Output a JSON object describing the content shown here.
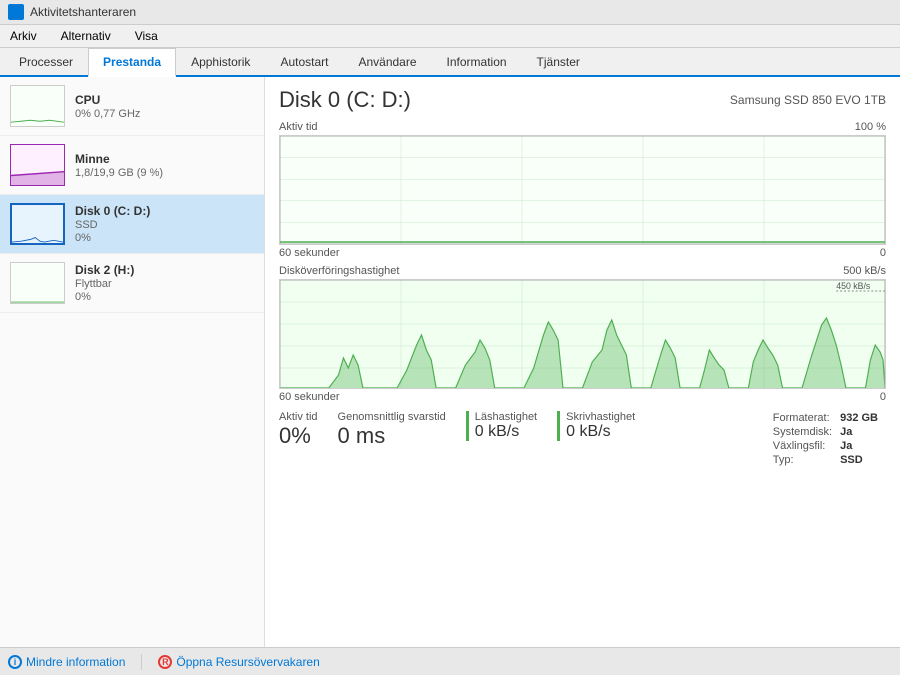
{
  "titleBar": {
    "text": "Aktivitetshanteraren",
    "iconColor": "#0078d7"
  },
  "menuBar": {
    "items": [
      "Arkiv",
      "Alternativ",
      "Visa"
    ]
  },
  "tabs": {
    "items": [
      "Processer",
      "Prestanda",
      "Apphistorik",
      "Autostart",
      "Användare",
      "Information",
      "Tjänster"
    ],
    "active": "Prestanda"
  },
  "sidebar": {
    "items": [
      {
        "id": "cpu",
        "name": "CPU",
        "sub1": "0% 0,77 GHz",
        "sub2": ""
      },
      {
        "id": "minne",
        "name": "Minne",
        "sub1": "1,8/19,9 GB (9 %)",
        "sub2": ""
      },
      {
        "id": "disk0",
        "name": "Disk 0 (C: D:)",
        "sub1": "SSD",
        "sub2": "0%"
      },
      {
        "id": "disk2",
        "name": "Disk 2 (H:)",
        "sub1": "Flyttbar",
        "sub2": "0%"
      }
    ]
  },
  "content": {
    "diskTitle": "Disk 0 (C: D:)",
    "diskModel": "Samsung SSD 850 EVO 1TB",
    "chart1": {
      "label": "Aktiv tid",
      "maxLabel": "100 %",
      "timeLabel": "60 sekunder",
      "minLabel": "0"
    },
    "chart2": {
      "label": "Disköverföringshastighet",
      "maxLabel": "500 kB/s",
      "refLabel": "450 kB/s",
      "timeLabel": "60 sekunder",
      "minLabel": "0"
    },
    "stats": {
      "activTime": {
        "label": "Aktiv tid",
        "value": "0%"
      },
      "avgResponse": {
        "label": "Genomsnittlig svarstid",
        "value": "0 ms"
      },
      "readSpeed": {
        "label": "Läshastighet",
        "value": "0 kB/s"
      },
      "writeSpeed": {
        "label": "Skrivhastighet",
        "value": "0 kB/s"
      }
    },
    "info": {
      "formatLabel": "Formaterat:",
      "formatValue": "932 GB",
      "systemDiskLabel": "Systemdisk:",
      "systemDiskValue": "Ja",
      "swapLabel": "Växlingsfil:",
      "swapValue": "Ja",
      "typeLabel": "Typ:",
      "typeValue": "SSD"
    }
  },
  "bottomBar": {
    "lessInfo": "Mindre information",
    "openResources": "Öppna Resursövervakaren"
  },
  "colors": {
    "accent": "#0078d7",
    "graphGreen": "#4caf50",
    "graphGreenFill": "rgba(76,175,80,0.3)",
    "selectedBg": "#cce4f7"
  }
}
